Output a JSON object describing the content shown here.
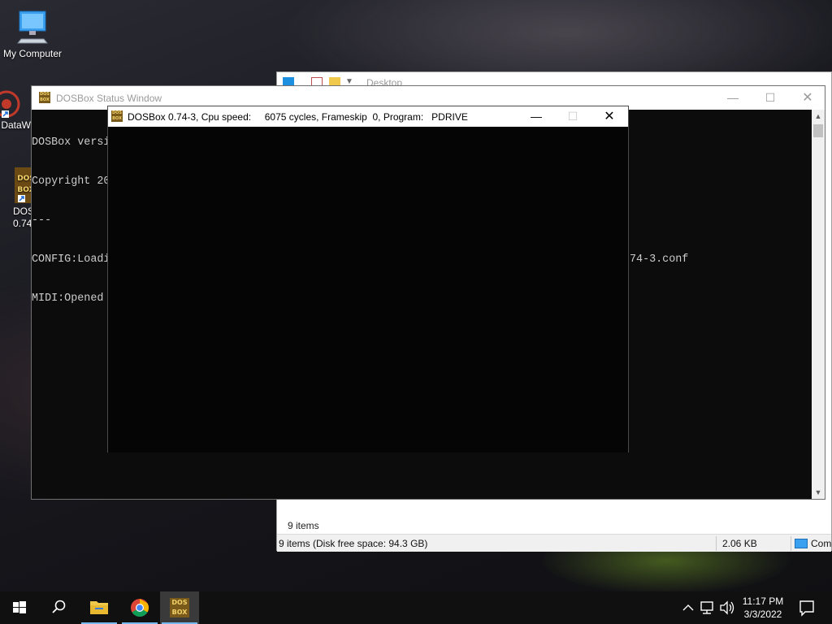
{
  "desktop": {
    "icons": [
      {
        "label": "My Computer"
      },
      {
        "label": "DataW"
      },
      {
        "label": "DOS\n0.74"
      }
    ]
  },
  "explorer": {
    "title": "Desktop",
    "items_count": "9 items",
    "status_left": "9 items (Disk free space: 94.3 GB)",
    "status_size": "2.06 KB",
    "status_computer": "Com"
  },
  "status_window": {
    "title": "DOSBox Status Window",
    "lines": [
      "DOSBox versi",
      "Copyright 20",
      "---",
      "CONFIG:Loadi",
      "MIDI:Opened "
    ],
    "line3_tail": "74-3.conf"
  },
  "dosbox": {
    "title": "DOSBox 0.74-3, Cpu speed:     6075 cycles, Frameskip  0, Program:   PDRIVE",
    "logo_text": "DOS BOX"
  },
  "taskbar": {
    "time": "11:17 PM",
    "date": "3/3/2022"
  },
  "colors": {
    "taskbar_bg": "#101010",
    "accent": "#76b9ed",
    "console_text": "#cccccc"
  }
}
